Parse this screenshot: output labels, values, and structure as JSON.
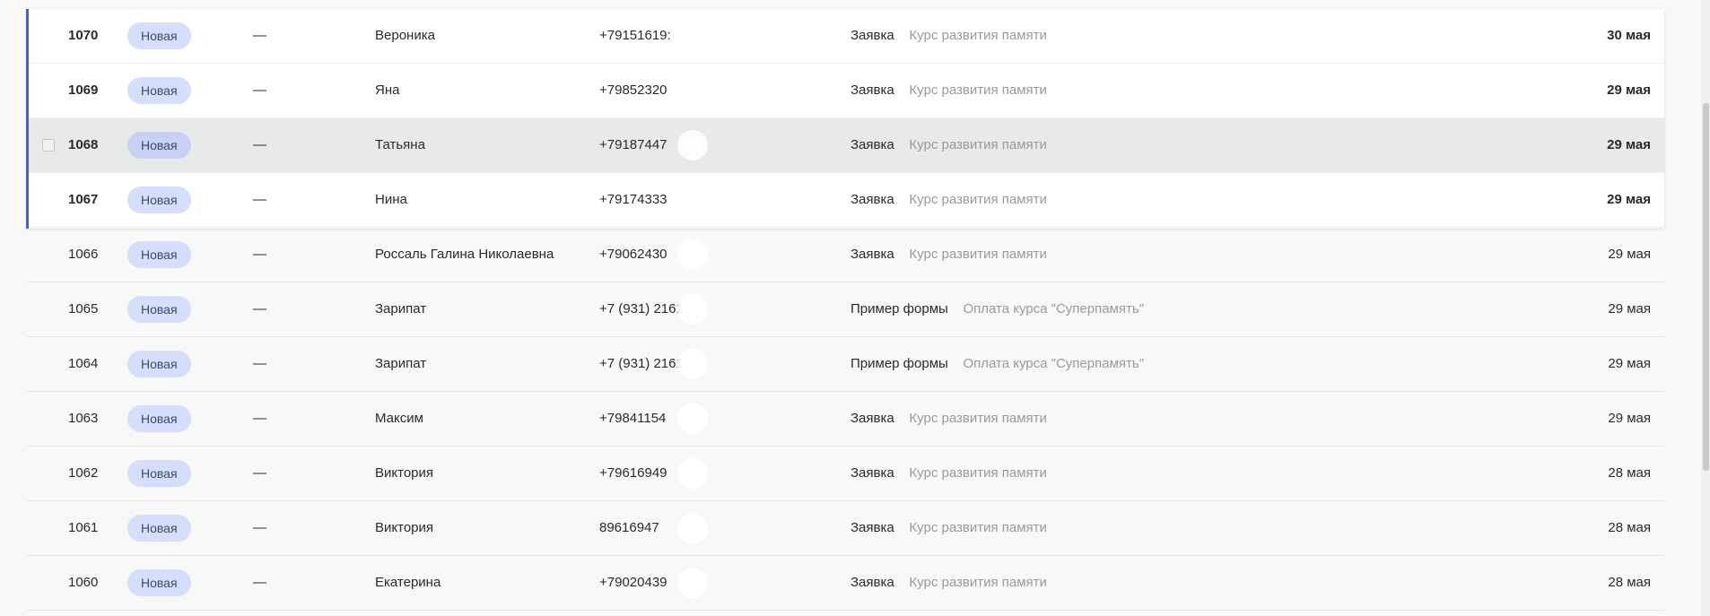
{
  "rows": [
    {
      "number": "1070",
      "status": "Новая",
      "assignee": "—",
      "name": "Вероника",
      "phone": "+79151619:",
      "type": "Заявка",
      "source": "Курс развития памяти",
      "date": "30 мая",
      "unread": true,
      "hover": false
    },
    {
      "number": "1069",
      "status": "Новая",
      "assignee": "—",
      "name": "Яна",
      "phone": "+79852320",
      "type": "Заявка",
      "source": "Курс развития памяти",
      "date": "29 мая",
      "unread": true,
      "hover": false
    },
    {
      "number": "1068",
      "status": "Новая",
      "assignee": "—",
      "name": "Татьяна",
      "phone": "+79187447",
      "type": "Заявка",
      "source": "Курс развития памяти",
      "date": "29 мая",
      "unread": true,
      "hover": true
    },
    {
      "number": "1067",
      "status": "Новая",
      "assignee": "—",
      "name": "Нина",
      "phone": "+79174333",
      "type": "Заявка",
      "source": "Курс развития памяти",
      "date": "29 мая",
      "unread": true,
      "hover": false
    },
    {
      "number": "1066",
      "status": "Новая",
      "assignee": "—",
      "name": "Россаль Галина Николаевна",
      "phone": "+79062430",
      "type": "Заявка",
      "source": "Курс развития памяти",
      "date": "29 мая",
      "unread": false,
      "hover": false
    },
    {
      "number": "1065",
      "status": "Новая",
      "assignee": "—",
      "name": "Зарипат",
      "phone": "+7 (931) 2161",
      "type": "Пример формы",
      "source": "Оплата курса \"Суперпамять\"",
      "date": "29 мая",
      "unread": false,
      "hover": false
    },
    {
      "number": "1064",
      "status": "Новая",
      "assignee": "—",
      "name": "Зарипат",
      "phone": "+7 (931) 2161",
      "type": "Пример формы",
      "source": "Оплата курса \"Суперпамять\"",
      "date": "29 мая",
      "unread": false,
      "hover": false
    },
    {
      "number": "1063",
      "status": "Новая",
      "assignee": "—",
      "name": "Максим",
      "phone": "+79841154",
      "type": "Заявка",
      "source": "Курс развития памяти",
      "date": "29 мая",
      "unread": false,
      "hover": false
    },
    {
      "number": "1062",
      "status": "Новая",
      "assignee": "—",
      "name": "Виктория",
      "phone": "+79616949",
      "type": "Заявка",
      "source": "Курс развития памяти",
      "date": "28 мая",
      "unread": false,
      "hover": false
    },
    {
      "number": "1061",
      "status": "Новая",
      "assignee": "—",
      "name": "Виктория",
      "phone": "89616947",
      "type": "Заявка",
      "source": "Курс развития памяти",
      "date": "28 мая",
      "unread": false,
      "hover": false
    },
    {
      "number": "1060",
      "status": "Новая",
      "assignee": "—",
      "name": "Екатерина",
      "phone": "+79020439",
      "type": "Заявка",
      "source": "Курс развития памяти",
      "date": "28 мая",
      "unread": false,
      "hover": false
    }
  ],
  "colors": {
    "accent": "#4060e0",
    "badge_bg": "#d5defa",
    "unread_bg": "#ffffff",
    "hover_bg": "#e8e9e9",
    "muted_text": "#9a9a9a"
  },
  "icons": {
    "row_checkbox": "checkbox-icon"
  }
}
